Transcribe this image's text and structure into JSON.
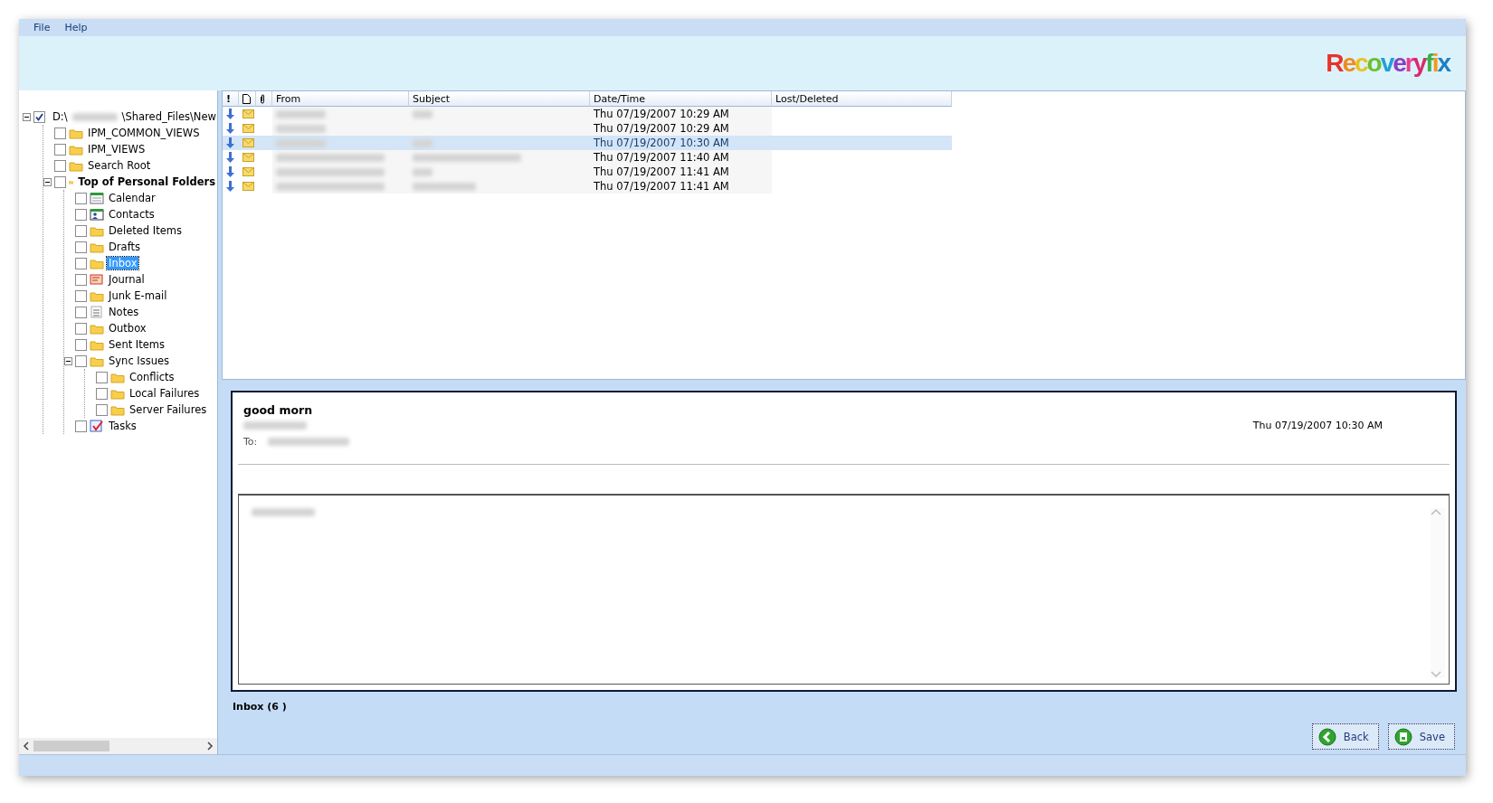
{
  "menu": [
    "File",
    "Help"
  ],
  "logo": "Recoveryfix",
  "tree": [
    {
      "label_start": "D:\\",
      "label_end": "\\Shared_Files\\New",
      "kind": "drive",
      "checked": true,
      "selected": false,
      "expanded": true,
      "children": [
        {
          "label": "IPM_COMMON_VIEWS",
          "kind": "folder",
          "checked": false,
          "selected": false
        },
        {
          "label": "IPM_VIEWS",
          "kind": "folder",
          "checked": false,
          "selected": false
        },
        {
          "label": "Search Root",
          "kind": "folder",
          "checked": false,
          "selected": false
        },
        {
          "label": "Top of Personal Folders",
          "kind": "folder",
          "bold": true,
          "checked": false,
          "selected": false,
          "expanded": true,
          "children": [
            {
              "label": "Calendar",
              "kind": "calendar",
              "checked": false,
              "selected": false
            },
            {
              "label": "Contacts",
              "kind": "contacts",
              "checked": false,
              "selected": false
            },
            {
              "label": "Deleted Items",
              "kind": "folder",
              "checked": false,
              "selected": false
            },
            {
              "label": "Drafts",
              "kind": "folder",
              "checked": false,
              "selected": false
            },
            {
              "label": "Inbox",
              "kind": "folder",
              "checked": false,
              "selected": true
            },
            {
              "label": "Journal",
              "kind": "journal",
              "checked": false,
              "selected": false
            },
            {
              "label": "Junk E-mail",
              "kind": "folder",
              "checked": false,
              "selected": false
            },
            {
              "label": "Notes",
              "kind": "notes",
              "checked": false,
              "selected": false
            },
            {
              "label": "Outbox",
              "kind": "folder",
              "checked": false,
              "selected": false
            },
            {
              "label": "Sent Items",
              "kind": "folder",
              "checked": false,
              "selected": false
            },
            {
              "label": "Sync Issues",
              "kind": "folder",
              "checked": false,
              "selected": false,
              "expanded": true,
              "children": [
                {
                  "label": "Conflicts",
                  "kind": "folder",
                  "checked": false,
                  "selected": false
                },
                {
                  "label": "Local Failures",
                  "kind": "folder",
                  "checked": false,
                  "selected": false
                },
                {
                  "label": "Server Failures",
                  "kind": "folder",
                  "checked": false,
                  "selected": false
                }
              ]
            },
            {
              "label": "Tasks",
              "kind": "tasks",
              "checked": false,
              "selected": false
            }
          ]
        }
      ]
    }
  ],
  "table": {
    "columns": [
      {
        "kind": "text",
        "label": "!"
      },
      {
        "kind": "page-icon"
      },
      {
        "kind": "clip-icon"
      },
      {
        "kind": "text",
        "label": "From"
      },
      {
        "kind": "text",
        "label": "Subject"
      },
      {
        "kind": "text",
        "label": "Date/Time"
      },
      {
        "kind": "text",
        "label": "Lost/Deleted"
      }
    ],
    "rows": [
      {
        "date": "Thu 07/19/2007 10:29 AM",
        "selected": false,
        "subject_blurred": true
      },
      {
        "date": "Thu 07/19/2007 10:29 AM",
        "selected": false,
        "subject_blurred": false
      },
      {
        "date": "Thu 07/19/2007 10:30 AM",
        "selected": true,
        "subject_blurred": true
      },
      {
        "date": "Thu 07/19/2007 11:40 AM",
        "selected": false,
        "subject_blurred": true
      },
      {
        "date": "Thu 07/19/2007 11:41 AM",
        "selected": false,
        "subject_blurred": true
      },
      {
        "date": "Thu 07/19/2007 11:41 AM",
        "selected": false,
        "subject_blurred": true
      }
    ]
  },
  "preview": {
    "subject": "good morn",
    "to_label": "To:",
    "date": "Thu 07/19/2007 10:30 AM"
  },
  "status": "Inbox (6 )",
  "buttons": [
    {
      "kind": "back",
      "label": "Back"
    },
    {
      "kind": "save",
      "label": "Save"
    }
  ]
}
